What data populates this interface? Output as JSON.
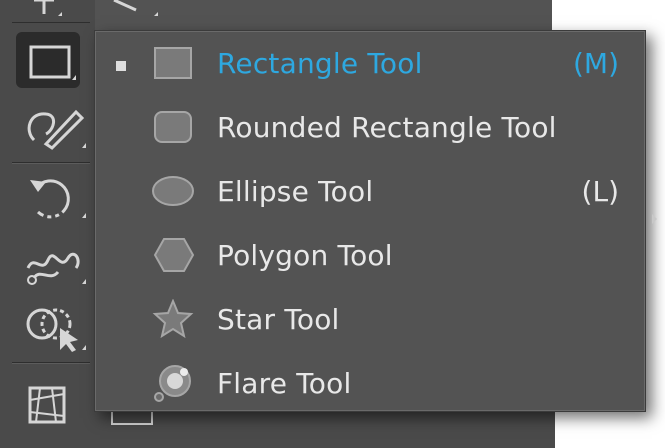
{
  "flyout": {
    "items": [
      {
        "label": "Rectangle Tool",
        "shortcut": "(M)",
        "selected": true,
        "icon": "rectangle-icon"
      },
      {
        "label": "Rounded Rectangle Tool",
        "shortcut": "",
        "selected": false,
        "icon": "rounded-rectangle-icon"
      },
      {
        "label": "Ellipse Tool",
        "shortcut": "(L)",
        "selected": false,
        "icon": "ellipse-icon"
      },
      {
        "label": "Polygon Tool",
        "shortcut": "",
        "selected": false,
        "icon": "polygon-icon"
      },
      {
        "label": "Star Tool",
        "shortcut": "",
        "selected": false,
        "icon": "star-icon"
      },
      {
        "label": "Flare Tool",
        "shortcut": "",
        "selected": false,
        "icon": "flare-icon"
      }
    ]
  },
  "toolbar": {
    "tools": [
      "type-tool-icon",
      "line-segment-tool-icon",
      "rectangle-tool-icon",
      "paintbrush-tool-icon",
      "rotate-tool-icon",
      "warp-tool-icon",
      "shape-builder-tool-icon",
      "perspective-grid-tool-icon"
    ]
  },
  "colors": {
    "selected_text": "#2ea8e0",
    "menu_text": "#e8e8e8",
    "menu_bg": "#535353",
    "toolbar_bg": "#4a4a4a"
  }
}
